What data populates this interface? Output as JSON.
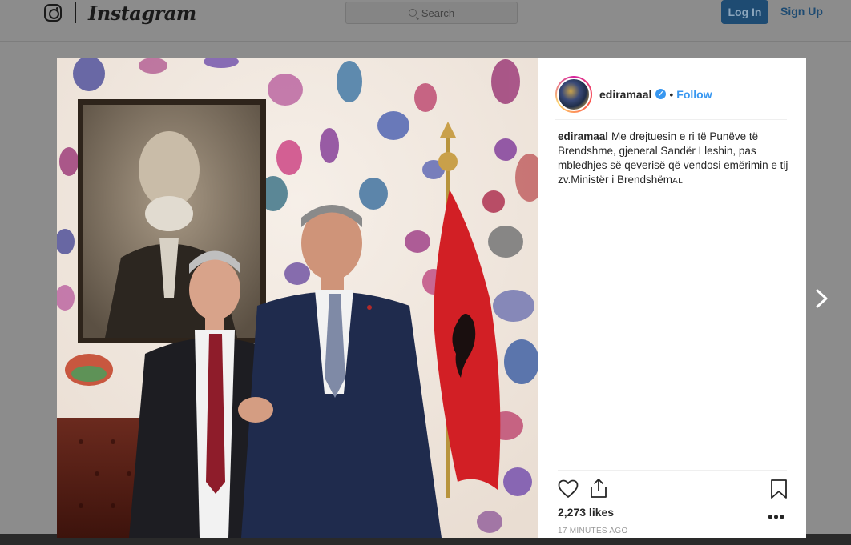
{
  "nav": {
    "wordmark": "Instagram",
    "search_placeholder": "Search",
    "login_label": "Log In",
    "signup_label": "Sign Up"
  },
  "post": {
    "username": "ediramaal",
    "follow_separator": "•",
    "follow_label": "Follow",
    "verified": true,
    "caption_username": "ediramaal",
    "caption_text": "Me drejtuesin e ri të Punëve të Brendshme, gjeneral Sandër Lleshin, pas mbledhjes së qeverisë që vendosi emërimin e tij zv.Ministër i Brendshëm",
    "caption_tail": "AL",
    "likes": "2,273 likes",
    "timestamp": "17 MINUTES AGO",
    "more_label": "•••"
  },
  "icons": {
    "logo": "instagram-camera-icon",
    "search": "search-icon",
    "like": "heart-icon",
    "share": "share-icon",
    "save": "bookmark-icon",
    "next": "chevron-right-icon",
    "verified": "verified-badge-icon"
  },
  "colors": {
    "accent": "#3897f0",
    "overlay": "#8c8c8c",
    "flag_red": "#d21f25"
  }
}
